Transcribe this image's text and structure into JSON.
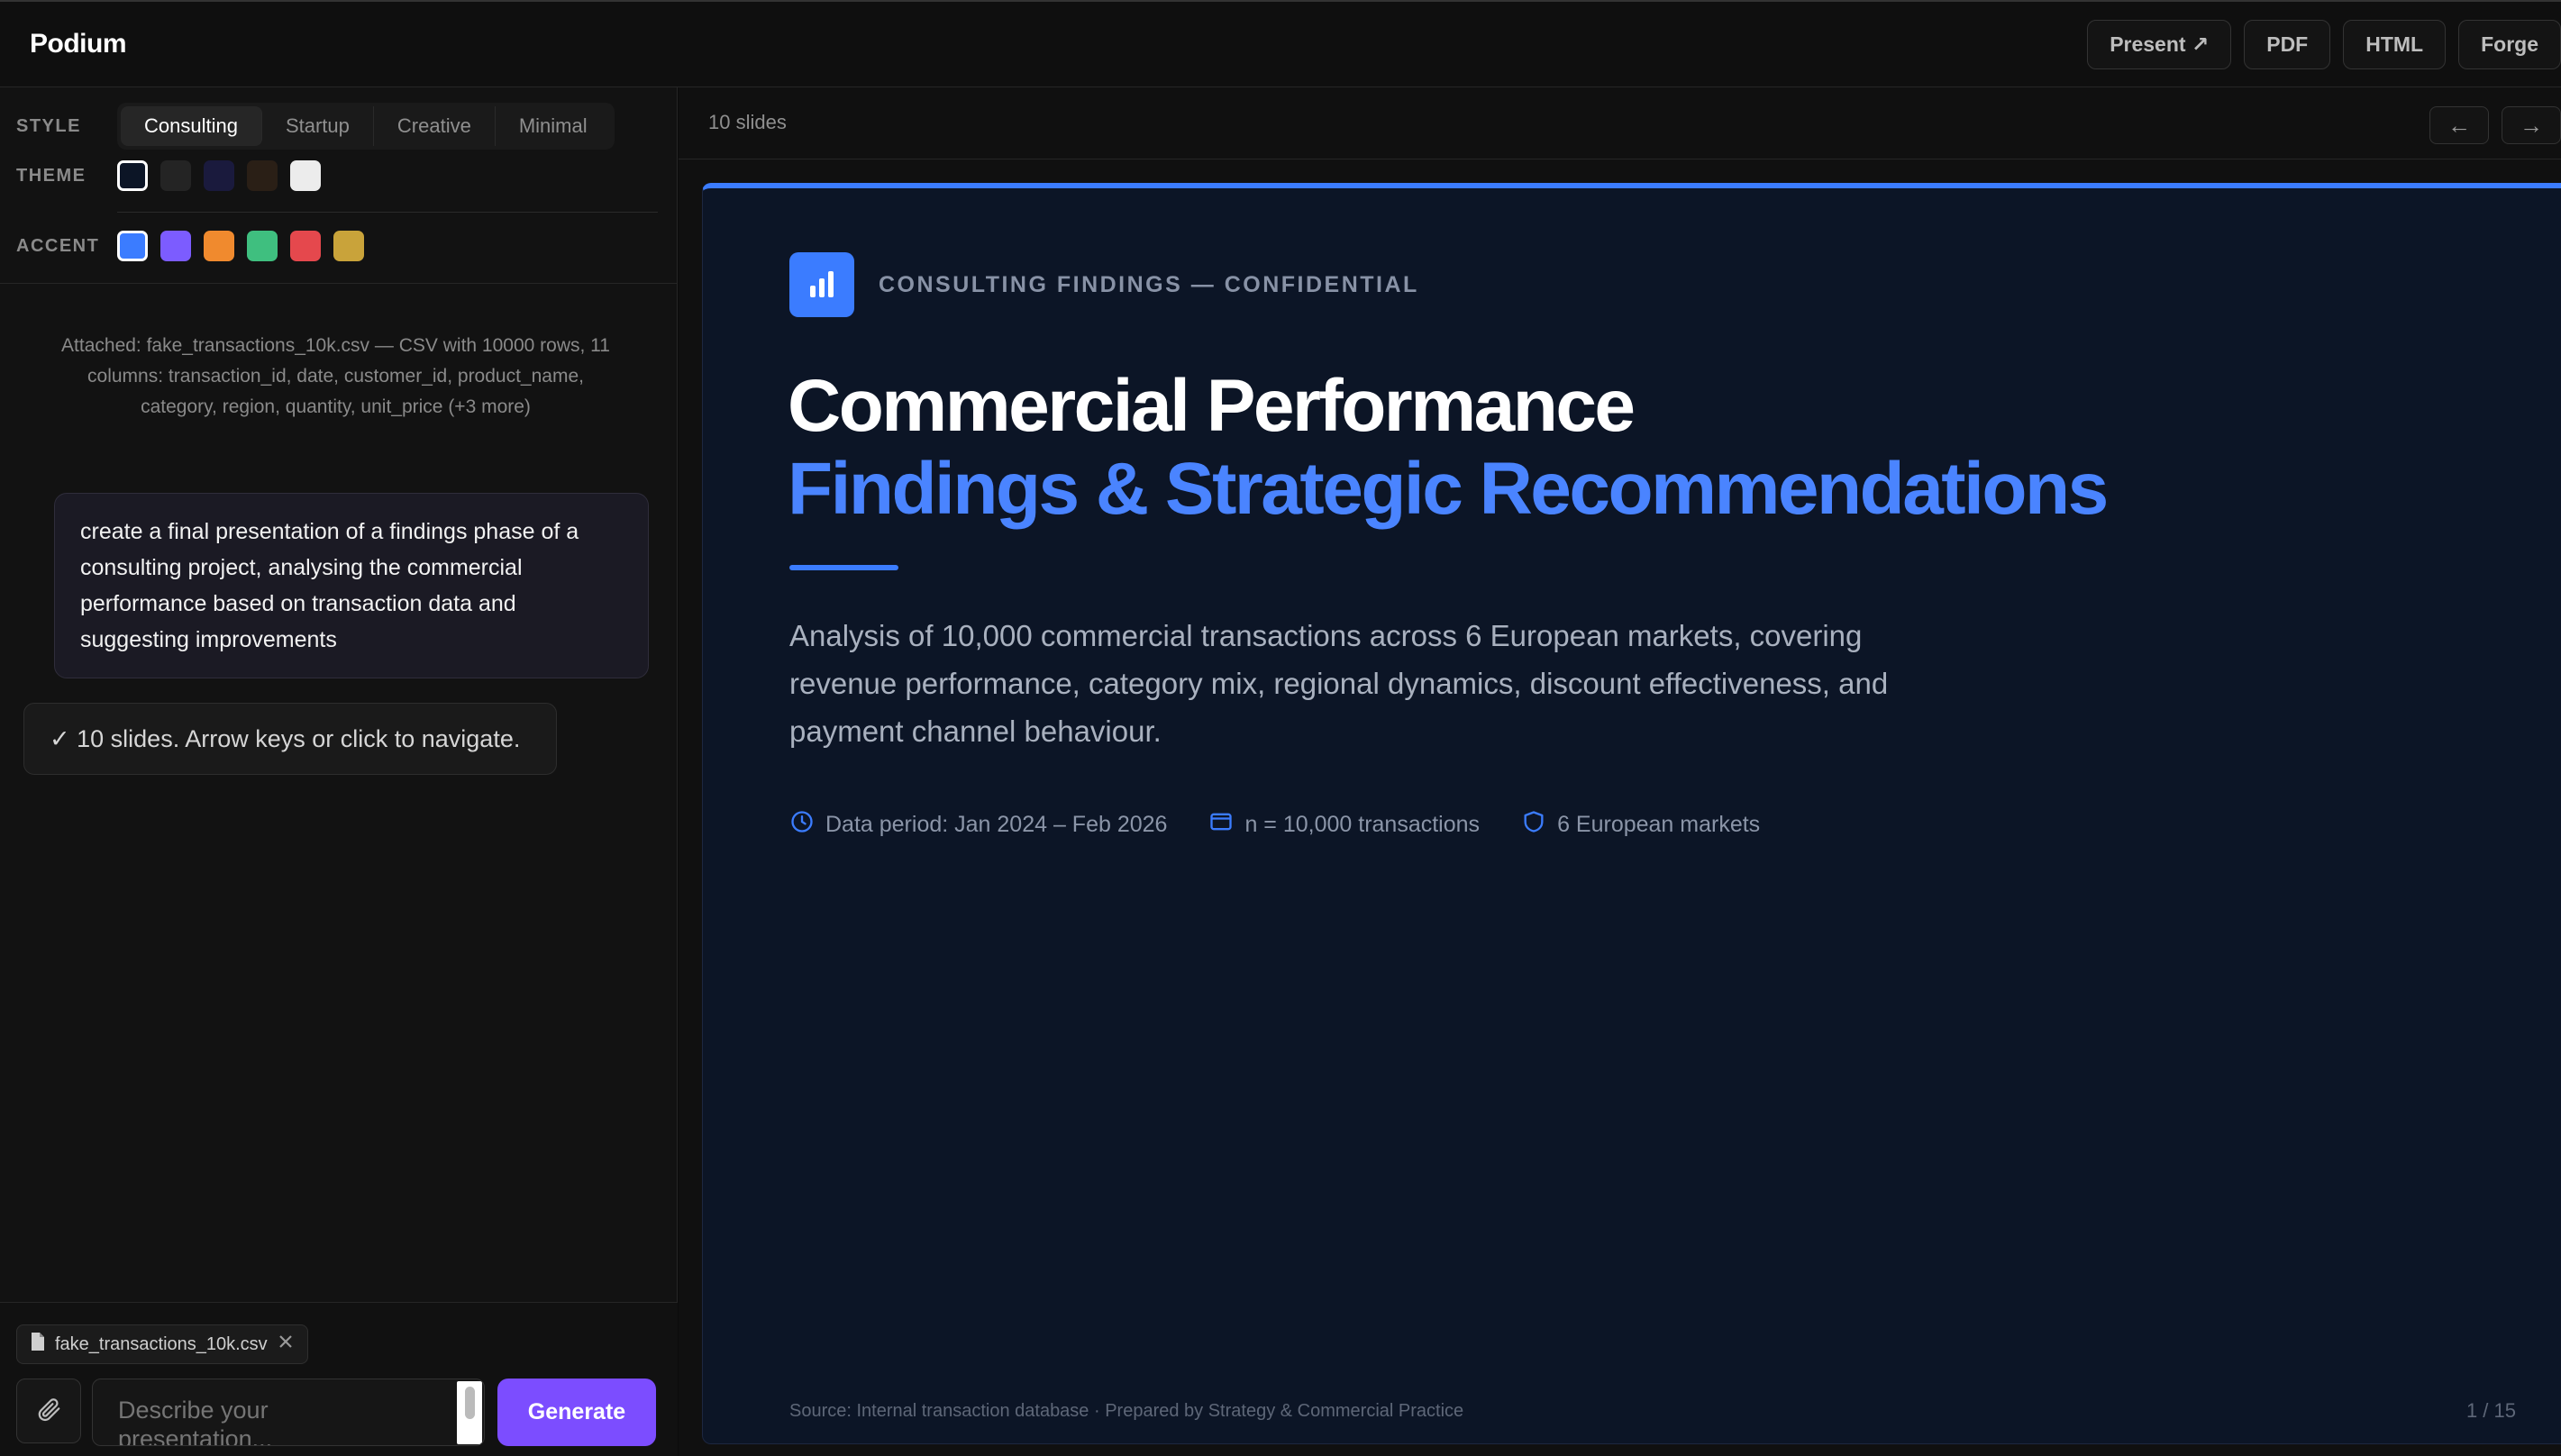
{
  "app": {
    "title": "Podium"
  },
  "toolbar": {
    "present": "Present ↗",
    "pdf": "PDF",
    "html": "HTML",
    "forge": "Forge"
  },
  "sidebar": {
    "style_label": "STYLE",
    "styles": [
      "Consulting",
      "Startup",
      "Creative",
      "Minimal"
    ],
    "active_style": "Consulting",
    "theme_label": "THEME",
    "themes": [
      "#0c1526",
      "#242424",
      "#1a1a3d",
      "#2a1f16",
      "#ececec"
    ],
    "accent_label": "ACCENT",
    "accents": [
      "#3b7cff",
      "#7c5cff",
      "#f08a2e",
      "#3fbf7f",
      "#e5484d",
      "#c9a33a"
    ]
  },
  "chat": {
    "attachment_note": "Attached: fake_transactions_10k.csv — CSV with 10000 rows, 11 columns: transaction_id, date, customer_id, product_name, category, region, quantity, unit_price (+3 more)",
    "user_message": "create a final presentation of a findings phase of a consulting project, analysing the commercial performance based on transaction data and suggesting improvements",
    "assistant_message": "✓ 10 slides. Arrow keys or click to navigate."
  },
  "composer": {
    "file_chip": "fake_transactions_10k.csv",
    "placeholder": "Describe your presentation...",
    "generate": "Generate"
  },
  "main": {
    "slide_count": "10 slides",
    "prev": "←",
    "next": "→"
  },
  "slide": {
    "eyebrow": "CONSULTING FINDINGS — CONFIDENTIAL",
    "title_line1": "Commercial Performance",
    "title_line2": "Findings & Strategic Recommendations",
    "subtitle": "Analysis of 10,000 commercial transactions across 6 European markets, covering revenue performance, category mix, regional dynamics, discount effectiveness, and payment channel behaviour.",
    "meta": [
      {
        "icon": "clock-icon",
        "text": "Data period: Jan 2024 – Feb 2026"
      },
      {
        "icon": "card-icon",
        "text": "n = 10,000 transactions"
      },
      {
        "icon": "shield-icon",
        "text": "6 European markets"
      }
    ],
    "footer": "Source: Internal transaction database · Prepared by Strategy & Commercial Practice",
    "page": "1 / 15"
  }
}
